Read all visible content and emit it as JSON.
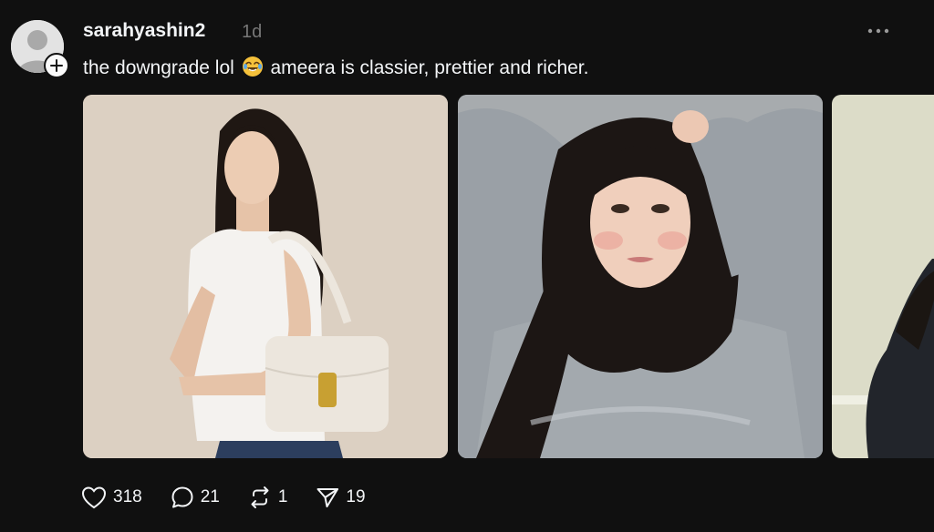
{
  "post": {
    "username": "sarahyashin2",
    "time": "1d",
    "caption_before_emoji": "the downgrade lol",
    "caption_emoji": "rolling-on-floor-laughing-emoji",
    "caption_after_emoji": "ameera is classier, prettier and richer.",
    "images": [
      {
        "icon": "photo-woman-white-top-handbag"
      },
      {
        "icon": "photo-woman-grey-sweatshirt"
      },
      {
        "icon": "photo-partial-third"
      }
    ]
  },
  "actions": {
    "likes": "318",
    "replies": "21",
    "reposts": "1",
    "shares": "19"
  },
  "colors": {
    "background": "#101010",
    "text": "#f3f5f7",
    "muted": "#777777"
  }
}
